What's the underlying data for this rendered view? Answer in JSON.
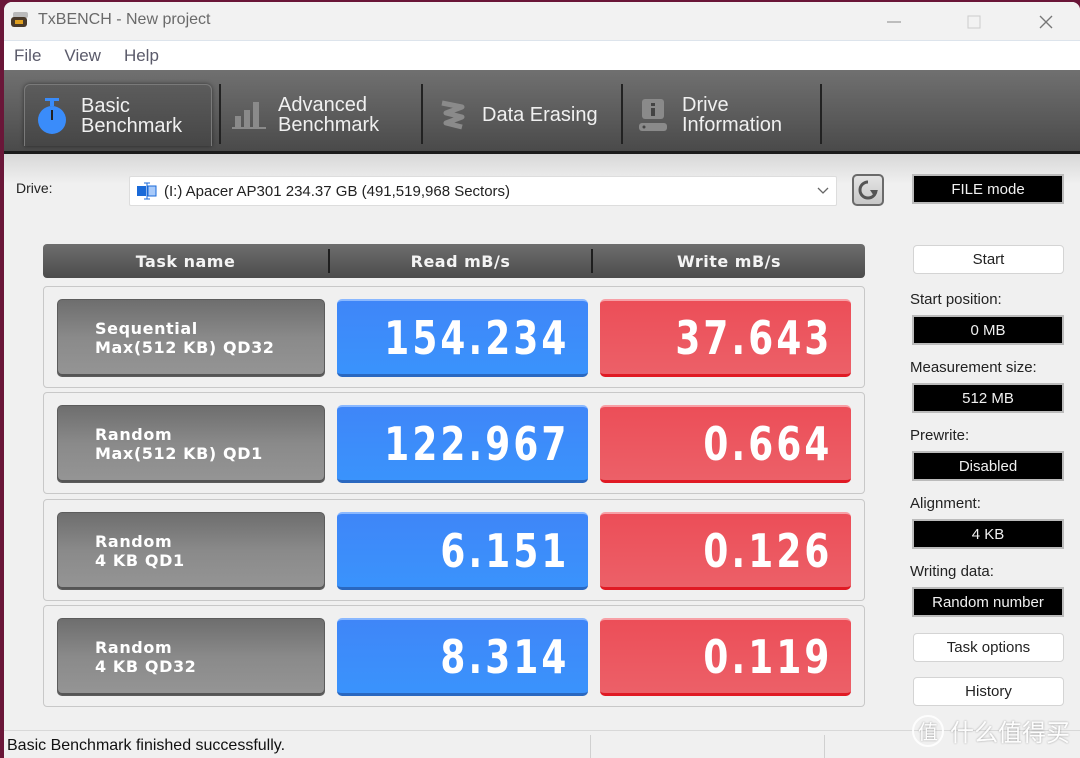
{
  "window": {
    "title": "TxBENCH - New project",
    "controls": {
      "minimize": "minimize",
      "maximize": "maximize",
      "close": "close"
    }
  },
  "menu": [
    "File",
    "View",
    "Help"
  ],
  "tabs": [
    {
      "line1": "Basic",
      "line2": "Benchmark",
      "icon": "stopwatch-icon",
      "active": true
    },
    {
      "line1": "Advanced",
      "line2": "Benchmark",
      "icon": "bar-chart-icon",
      "active": false
    },
    {
      "line1": "Data Erasing",
      "line2": "",
      "icon": "eraser-icon",
      "active": false
    },
    {
      "line1": "Drive",
      "line2": "Information",
      "icon": "drive-info-icon",
      "active": false
    }
  ],
  "drive": {
    "label": "Drive:",
    "selected": "(I:) Apacer AP301  234.37 GB (491,519,968 Sectors)"
  },
  "table": {
    "headers": [
      "Task name",
      "Read mB/s",
      "Write mB/s"
    ],
    "rows": [
      {
        "name1": "Sequential",
        "name2": "Max(512 KB) QD32",
        "read": "154.234",
        "write": "37.643"
      },
      {
        "name1": "Random",
        "name2": "Max(512 KB) QD1",
        "read": "122.967",
        "write": "0.664"
      },
      {
        "name1": "Random",
        "name2": "4 KB QD1",
        "read": "6.151",
        "write": "0.126"
      },
      {
        "name1": "Random",
        "name2": "4 KB QD32",
        "read": "8.314",
        "write": "0.119"
      }
    ]
  },
  "side": {
    "mode": "FILE mode",
    "start_button": "Start",
    "start_position_label": "Start position:",
    "start_position": "0 MB",
    "measurement_size_label": "Measurement size:",
    "measurement_size": "512 MB",
    "prewrite_label": "Prewrite:",
    "prewrite": "Disabled",
    "alignment_label": "Alignment:",
    "alignment": "4 KB",
    "writing_data_label": "Writing data:",
    "writing_data": "Random number",
    "task_options_button": "Task options",
    "history_button": "History"
  },
  "status": {
    "message": "Basic Benchmark finished successfully."
  },
  "watermark": {
    "circle": "值",
    "text": "什么值得买"
  },
  "colors": {
    "read": "#3a8cfa",
    "write": "#ec5660",
    "task": "#808080",
    "stopwatch": "#3a8cfa"
  }
}
